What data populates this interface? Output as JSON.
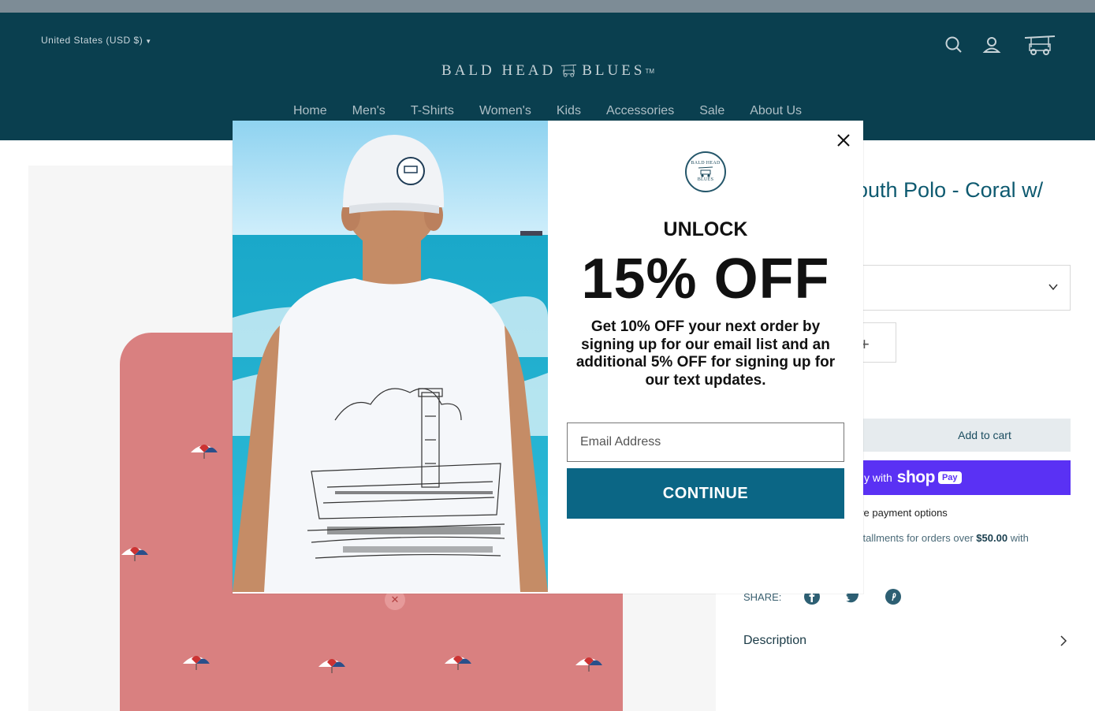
{
  "header": {
    "currency": "United States (USD $)",
    "logo_left": "BALD HEAD",
    "logo_right": "BLUES",
    "logo_tm": "TM",
    "nav": [
      "Home",
      "Men's",
      "T-Shirts",
      "Women's",
      "Kids",
      "Accessories",
      "Sale",
      "About Us"
    ]
  },
  "product": {
    "title_visible": "outh Polo - Coral w/",
    "add_to_cart": "Add to cart",
    "shop_pay_prefix": "y with",
    "shop_pay_logo": "shop",
    "shop_pay_badge": "Pay",
    "more_payment": "ore payment options",
    "installments_text": "stallments for orders over",
    "installments_amount": "$50.00",
    "installments_suffix": "with",
    "share_label": "SHARE:",
    "description_label": "Description"
  },
  "popup": {
    "seal_line1": "BALD HEAD",
    "seal_line2": "BLUES",
    "unlock": "UNLOCK",
    "headline": "15% OFF",
    "subtext": "Get 10% OFF your next order by signing up for our email list and an additional 5% OFF for signing up for our text updates.",
    "email_placeholder": "Email Address",
    "cta": "CONTINUE"
  },
  "colors": {
    "header_bg": "#0a3f4f",
    "cta_bg": "#0b6685",
    "shop_pay": "#5a31f4",
    "shirt": "#d98080"
  }
}
